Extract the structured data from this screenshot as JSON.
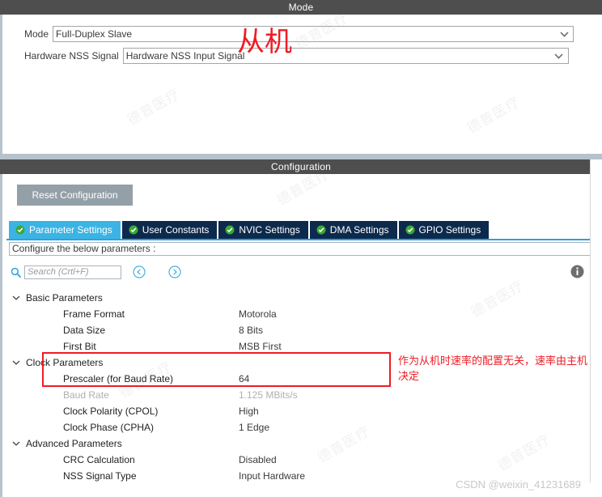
{
  "mode_panel": {
    "title": "Mode",
    "rows": [
      {
        "label": "Mode",
        "value": "Full-Duplex Slave"
      },
      {
        "label": "Hardware NSS Signal",
        "value": "Hardware NSS Input Signal"
      }
    ]
  },
  "config_panel": {
    "title": "Configuration",
    "reset_label": "Reset Configuration",
    "tabs": [
      {
        "label": "Parameter Settings",
        "active": true
      },
      {
        "label": "User Constants",
        "active": false
      },
      {
        "label": "NVIC Settings",
        "active": false
      },
      {
        "label": "DMA Settings",
        "active": false
      },
      {
        "label": "GPIO Settings",
        "active": false
      }
    ],
    "configure_text": "Configure the below parameters :",
    "search_placeholder": "Search (Crtl+F)",
    "search_value": "",
    "groups": [
      {
        "name": "Basic Parameters",
        "rows": [
          {
            "key": "Frame Format",
            "value": "Motorola",
            "dim": false
          },
          {
            "key": "Data Size",
            "value": "8 Bits",
            "dim": false
          },
          {
            "key": "First Bit",
            "value": "MSB First",
            "dim": false
          }
        ]
      },
      {
        "name": "Clock Parameters",
        "rows": [
          {
            "key": "Prescaler (for Baud Rate)",
            "value": "64",
            "dim": false
          },
          {
            "key": "Baud Rate",
            "value": "1.125 MBits/s",
            "dim": true
          },
          {
            "key": "Clock Polarity (CPOL)",
            "value": "High",
            "dim": false
          },
          {
            "key": "Clock Phase (CPHA)",
            "value": "1 Edge",
            "dim": false
          }
        ]
      },
      {
        "name": "Advanced Parameters",
        "rows": [
          {
            "key": "CRC Calculation",
            "value": "Disabled",
            "dim": false
          },
          {
            "key": "NSS Signal Type",
            "value": "Input Hardware",
            "dim": false
          }
        ]
      }
    ]
  },
  "annotations": {
    "slave_label": "从机",
    "baud_note": "作为从机时速率的配置无关，速率由主机决定",
    "color": "#ee1c25"
  },
  "watermarks": {
    "csdn": "CSDN @weixin_41231689",
    "tiled": "德普医疗"
  },
  "colors": {
    "header_bar": "#4e4e4e",
    "active_tab": "#3bb4e5",
    "inactive_tab": "#0d2a4d",
    "reset_button": "#94a0a8",
    "accent_line": "#29a3dd",
    "check_green": "#3aaa35"
  }
}
